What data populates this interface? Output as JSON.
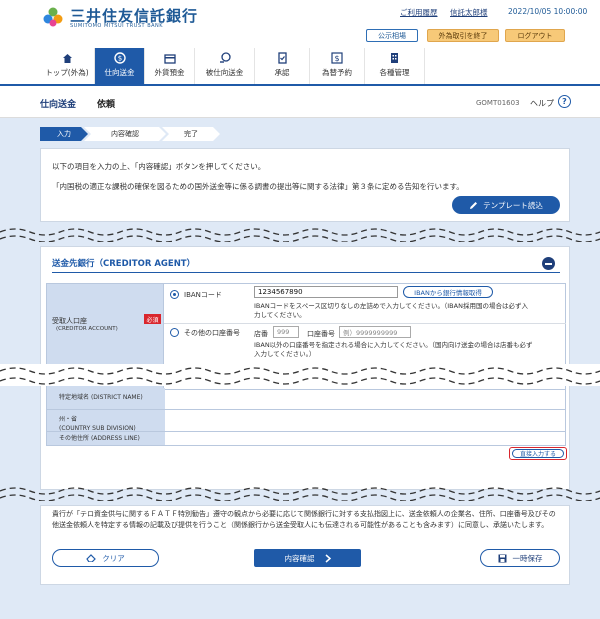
{
  "header": {
    "bank_name_jp": "三井住友信託銀行",
    "bank_name_en": "SUMITOMO MITSUI TRUST BANK",
    "links": [
      "ご利用履歴",
      "信託太郎様"
    ],
    "timestamp": "2022/10/05 10:00:00",
    "btn_public_list": "公示相場",
    "btn_fx_end": "外為取引を終了",
    "btn_logout": "ログアウト"
  },
  "nav": [
    {
      "label": "トップ(外為)",
      "icon": "home-icon"
    },
    {
      "label": "仕向送金",
      "icon": "money-send-icon",
      "active": true
    },
    {
      "label": "外貨預金",
      "icon": "deposit-icon"
    },
    {
      "label": "被仕向送金",
      "icon": "money-receive-icon"
    },
    {
      "label": "承認",
      "icon": "approve-icon"
    },
    {
      "label": "為替予約",
      "icon": "exchange-icon"
    },
    {
      "label": "各種管理",
      "icon": "building-icon"
    }
  ],
  "title": {
    "main": "仕向送金",
    "sub": "依頼",
    "screen_code": "GOMT01603",
    "help": "ヘルプ"
  },
  "steps": [
    "入力",
    "内容確認",
    "完了"
  ],
  "intro": {
    "line1": "以下の項目を入力の上、「内容確認」ボタンを押してください。",
    "line2": "「内国税の適正な課税の確保を図るための国外送金等に係る調書の提出等に関する法律」第３条に定める告知を行います。",
    "template_button": "テンプレート読込"
  },
  "creditor_agent": {
    "title": "送金先銀行（CREDITOR AGENT）",
    "field_label": "受取人口座",
    "field_label_en": "(CREDITOR ACCOUNT)",
    "required": "必須",
    "option_iban": {
      "label": "IBANコード",
      "value": "1234567890",
      "lookup_button": "IBANから銀行情報取得",
      "help_1": "IBANコードをスペース区切りなしの左詰めで入力してください。（IBAN採用国の場合は必ず入",
      "help_2": "力してください。"
    },
    "option_other": {
      "label": "その他の口座番号",
      "branch_label": "店番",
      "branch_placeholder": "999",
      "account_label": "口座番号",
      "account_placeholder": "例）9999999999",
      "help_1": "IBAN以外の口座番号を指定される場合に入力してください。（国内向け送金の場合は店番も必ず",
      "help_2": "入力してください。）"
    },
    "rows": [
      {
        "label": "特定地域名",
        "label_en": "(DISTRICT NAME)"
      },
      {
        "label": "州・省",
        "label_en": "(COUNTRY SUB DIVISION)"
      },
      {
        "label": "その他住所",
        "label_en": "(ADDRESS LINE)"
      }
    ],
    "direct_input_button": "直接入力する"
  },
  "footer": {
    "notice": "貴行が「テロ資金供与に関するＦＡＴＦ特別勧告」遵守の観点から必要に応じて関係銀行に対する支払指図上に、送金依頼人の企業名、住所、口座番号及びその他送金依頼人を特定する情報の記載及び提供を行うこと（関係銀行から送金受取人にも伝達される可能性があることも含みます）に同意し、承諾いたします。",
    "clear_button": "クリア",
    "confirm_button": "内容確認",
    "save_button": "一時保存"
  }
}
